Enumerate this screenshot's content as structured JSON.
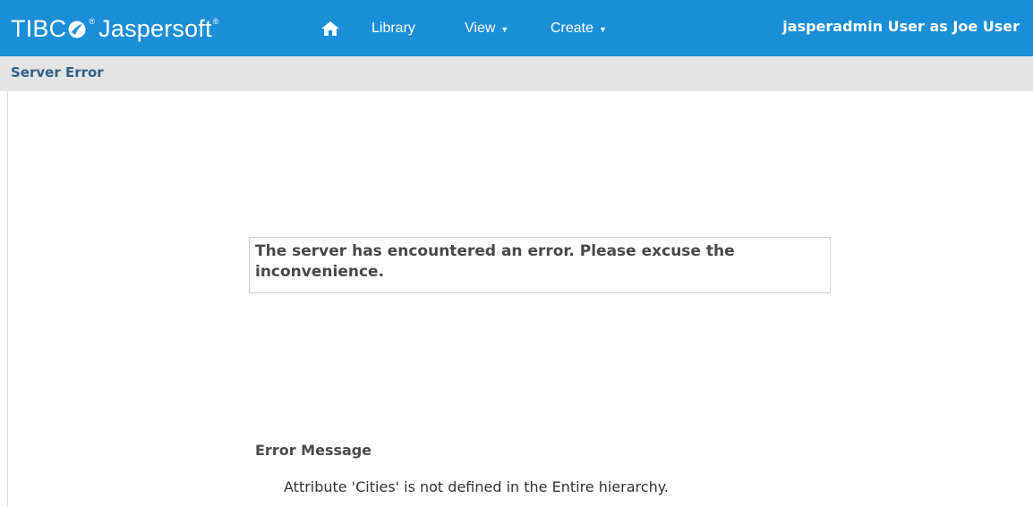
{
  "header": {
    "logo_text_tibco": "TIBC",
    "logo_text_rest": "Jaspersoft",
    "logo_reg": "®",
    "home_icon": "home-icon",
    "nav": [
      {
        "label": "Library",
        "has_caret": false
      },
      {
        "label": "View",
        "has_caret": true
      },
      {
        "label": "Create",
        "has_caret": true
      }
    ],
    "user_label": "jasperadmin User as Joe User",
    "bg_color": "#1b8ed8"
  },
  "page": {
    "title": "Server Error",
    "error_box_text": "The server has encountered an error. Please excuse the inconvenience.",
    "error_message_heading": "Error Message",
    "error_message_detail": "Attribute 'Cities' is not defined in the Entire hierarchy."
  }
}
